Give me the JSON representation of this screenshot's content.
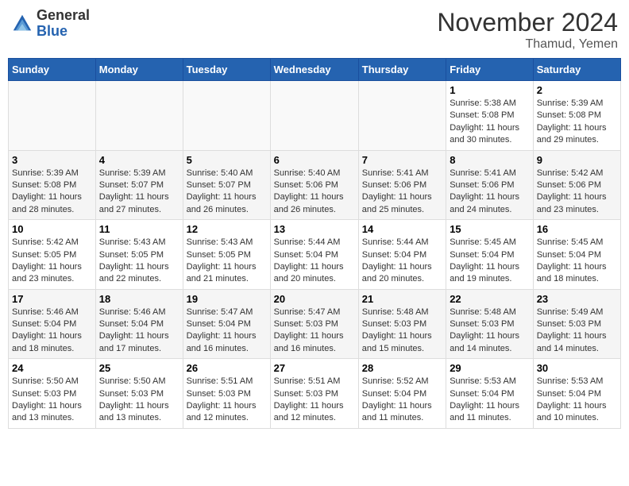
{
  "header": {
    "logo_general": "General",
    "logo_blue": "Blue",
    "month_title": "November 2024",
    "location": "Thamud, Yemen"
  },
  "days_of_week": [
    "Sunday",
    "Monday",
    "Tuesday",
    "Wednesday",
    "Thursday",
    "Friday",
    "Saturday"
  ],
  "weeks": [
    [
      {
        "day": "",
        "sunrise": "",
        "sunset": "",
        "daylight": ""
      },
      {
        "day": "",
        "sunrise": "",
        "sunset": "",
        "daylight": ""
      },
      {
        "day": "",
        "sunrise": "",
        "sunset": "",
        "daylight": ""
      },
      {
        "day": "",
        "sunrise": "",
        "sunset": "",
        "daylight": ""
      },
      {
        "day": "",
        "sunrise": "",
        "sunset": "",
        "daylight": ""
      },
      {
        "day": "1",
        "sunrise": "Sunrise: 5:38 AM",
        "sunset": "Sunset: 5:08 PM",
        "daylight": "Daylight: 11 hours and 30 minutes."
      },
      {
        "day": "2",
        "sunrise": "Sunrise: 5:39 AM",
        "sunset": "Sunset: 5:08 PM",
        "daylight": "Daylight: 11 hours and 29 minutes."
      }
    ],
    [
      {
        "day": "3",
        "sunrise": "Sunrise: 5:39 AM",
        "sunset": "Sunset: 5:08 PM",
        "daylight": "Daylight: 11 hours and 28 minutes."
      },
      {
        "day": "4",
        "sunrise": "Sunrise: 5:39 AM",
        "sunset": "Sunset: 5:07 PM",
        "daylight": "Daylight: 11 hours and 27 minutes."
      },
      {
        "day": "5",
        "sunrise": "Sunrise: 5:40 AM",
        "sunset": "Sunset: 5:07 PM",
        "daylight": "Daylight: 11 hours and 26 minutes."
      },
      {
        "day": "6",
        "sunrise": "Sunrise: 5:40 AM",
        "sunset": "Sunset: 5:06 PM",
        "daylight": "Daylight: 11 hours and 26 minutes."
      },
      {
        "day": "7",
        "sunrise": "Sunrise: 5:41 AM",
        "sunset": "Sunset: 5:06 PM",
        "daylight": "Daylight: 11 hours and 25 minutes."
      },
      {
        "day": "8",
        "sunrise": "Sunrise: 5:41 AM",
        "sunset": "Sunset: 5:06 PM",
        "daylight": "Daylight: 11 hours and 24 minutes."
      },
      {
        "day": "9",
        "sunrise": "Sunrise: 5:42 AM",
        "sunset": "Sunset: 5:06 PM",
        "daylight": "Daylight: 11 hours and 23 minutes."
      }
    ],
    [
      {
        "day": "10",
        "sunrise": "Sunrise: 5:42 AM",
        "sunset": "Sunset: 5:05 PM",
        "daylight": "Daylight: 11 hours and 23 minutes."
      },
      {
        "day": "11",
        "sunrise": "Sunrise: 5:43 AM",
        "sunset": "Sunset: 5:05 PM",
        "daylight": "Daylight: 11 hours and 22 minutes."
      },
      {
        "day": "12",
        "sunrise": "Sunrise: 5:43 AM",
        "sunset": "Sunset: 5:05 PM",
        "daylight": "Daylight: 11 hours and 21 minutes."
      },
      {
        "day": "13",
        "sunrise": "Sunrise: 5:44 AM",
        "sunset": "Sunset: 5:04 PM",
        "daylight": "Daylight: 11 hours and 20 minutes."
      },
      {
        "day": "14",
        "sunrise": "Sunrise: 5:44 AM",
        "sunset": "Sunset: 5:04 PM",
        "daylight": "Daylight: 11 hours and 20 minutes."
      },
      {
        "day": "15",
        "sunrise": "Sunrise: 5:45 AM",
        "sunset": "Sunset: 5:04 PM",
        "daylight": "Daylight: 11 hours and 19 minutes."
      },
      {
        "day": "16",
        "sunrise": "Sunrise: 5:45 AM",
        "sunset": "Sunset: 5:04 PM",
        "daylight": "Daylight: 11 hours and 18 minutes."
      }
    ],
    [
      {
        "day": "17",
        "sunrise": "Sunrise: 5:46 AM",
        "sunset": "Sunset: 5:04 PM",
        "daylight": "Daylight: 11 hours and 18 minutes."
      },
      {
        "day": "18",
        "sunrise": "Sunrise: 5:46 AM",
        "sunset": "Sunset: 5:04 PM",
        "daylight": "Daylight: 11 hours and 17 minutes."
      },
      {
        "day": "19",
        "sunrise": "Sunrise: 5:47 AM",
        "sunset": "Sunset: 5:04 PM",
        "daylight": "Daylight: 11 hours and 16 minutes."
      },
      {
        "day": "20",
        "sunrise": "Sunrise: 5:47 AM",
        "sunset": "Sunset: 5:03 PM",
        "daylight": "Daylight: 11 hours and 16 minutes."
      },
      {
        "day": "21",
        "sunrise": "Sunrise: 5:48 AM",
        "sunset": "Sunset: 5:03 PM",
        "daylight": "Daylight: 11 hours and 15 minutes."
      },
      {
        "day": "22",
        "sunrise": "Sunrise: 5:48 AM",
        "sunset": "Sunset: 5:03 PM",
        "daylight": "Daylight: 11 hours and 14 minutes."
      },
      {
        "day": "23",
        "sunrise": "Sunrise: 5:49 AM",
        "sunset": "Sunset: 5:03 PM",
        "daylight": "Daylight: 11 hours and 14 minutes."
      }
    ],
    [
      {
        "day": "24",
        "sunrise": "Sunrise: 5:50 AM",
        "sunset": "Sunset: 5:03 PM",
        "daylight": "Daylight: 11 hours and 13 minutes."
      },
      {
        "day": "25",
        "sunrise": "Sunrise: 5:50 AM",
        "sunset": "Sunset: 5:03 PM",
        "daylight": "Daylight: 11 hours and 13 minutes."
      },
      {
        "day": "26",
        "sunrise": "Sunrise: 5:51 AM",
        "sunset": "Sunset: 5:03 PM",
        "daylight": "Daylight: 11 hours and 12 minutes."
      },
      {
        "day": "27",
        "sunrise": "Sunrise: 5:51 AM",
        "sunset": "Sunset: 5:03 PM",
        "daylight": "Daylight: 11 hours and 12 minutes."
      },
      {
        "day": "28",
        "sunrise": "Sunrise: 5:52 AM",
        "sunset": "Sunset: 5:04 PM",
        "daylight": "Daylight: 11 hours and 11 minutes."
      },
      {
        "day": "29",
        "sunrise": "Sunrise: 5:53 AM",
        "sunset": "Sunset: 5:04 PM",
        "daylight": "Daylight: 11 hours and 11 minutes."
      },
      {
        "day": "30",
        "sunrise": "Sunrise: 5:53 AM",
        "sunset": "Sunset: 5:04 PM",
        "daylight": "Daylight: 11 hours and 10 minutes."
      }
    ]
  ]
}
